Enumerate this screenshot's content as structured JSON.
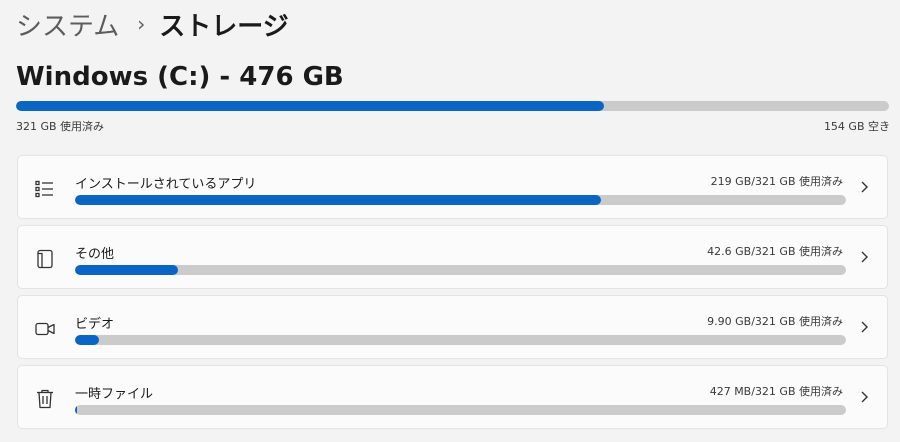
{
  "breadcrumb": {
    "parent": "システム",
    "separator": "›",
    "current": "ストレージ"
  },
  "drive": {
    "title": "Windows (C:) - 476 GB",
    "used_fraction": 0.674,
    "used_label": "321 GB 使用済み",
    "free_label": "154 GB 空き"
  },
  "categories": [
    {
      "icon": "app-list-icon",
      "label": "インストールされているアプリ",
      "size": "219 GB/321 GB 使用済み",
      "fraction": 0.682
    },
    {
      "icon": "other-files-icon",
      "label": "その他",
      "size": "42.6 GB/321 GB 使用済み",
      "fraction": 0.133
    },
    {
      "icon": "video-camera-icon",
      "label": "ビデオ",
      "size": "9.90 GB/321 GB 使用済み",
      "fraction": 0.031
    },
    {
      "icon": "trash-icon",
      "label": "一時ファイル",
      "size": "427 MB/321 GB 使用済み",
      "fraction": 0.003
    }
  ],
  "colors": {
    "accent": "#0a66c2",
    "track": "#cbcbcb",
    "background": "#f3f3f3",
    "card": "#fbfbfb"
  }
}
